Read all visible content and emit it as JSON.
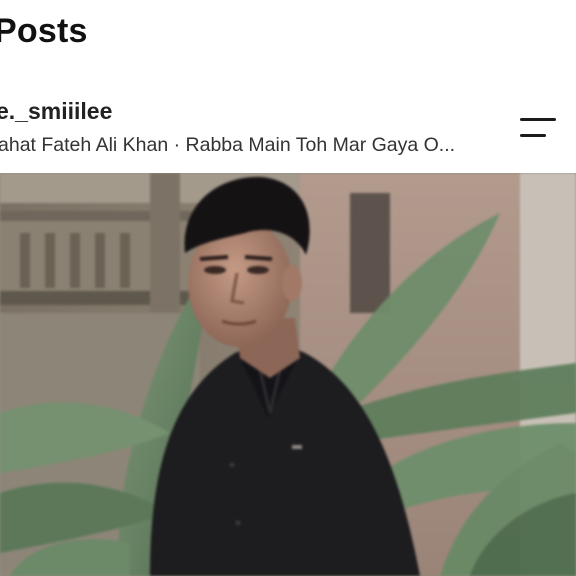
{
  "header": {
    "title": "Posts"
  },
  "post": {
    "username": "e._smiiilee",
    "audio": "ahat Fateh Ali Khan · Rabba Main Toh Mar Gaya O...",
    "menu_icon": "hamburger-menu-icon",
    "photo_description": ""
  }
}
